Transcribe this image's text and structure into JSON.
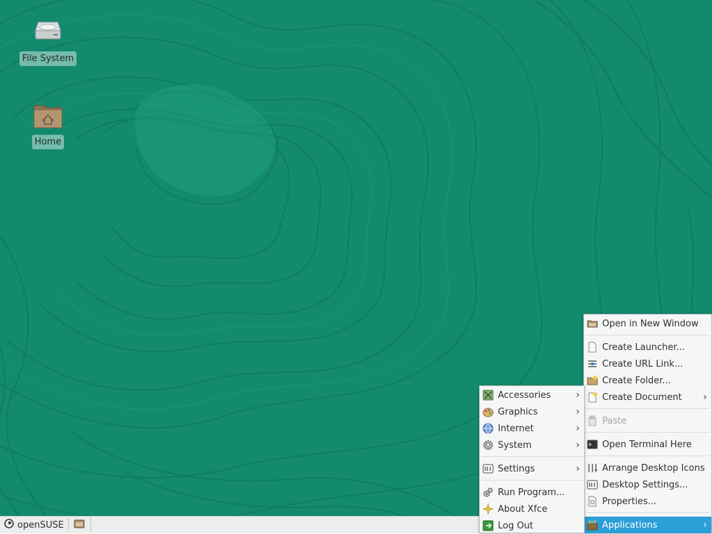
{
  "desktop": {
    "icons": [
      {
        "label": "File System",
        "icon": "drive-icon"
      },
      {
        "label": "Home",
        "icon": "home-folder-icon"
      }
    ]
  },
  "taskbar": {
    "menu_label": "openSUSE",
    "menu_icon": "opensuse-logo-icon",
    "show_desktop_icon": "show-desktop-icon"
  },
  "context_menu": {
    "items": [
      {
        "label": "Open in New Window",
        "icon": "folder-open-icon"
      },
      {
        "label": "Create Launcher...",
        "icon": "document-icon"
      },
      {
        "label": "Create URL Link...",
        "icon": "link-icon"
      },
      {
        "label": "Create Folder...",
        "icon": "new-folder-icon"
      },
      {
        "label": "Create Document",
        "icon": "new-document-icon"
      },
      {
        "label": "Paste",
        "icon": "paste-icon"
      },
      {
        "label": "Open Terminal Here",
        "icon": "terminal-icon"
      },
      {
        "label": "Arrange Desktop Icons",
        "icon": "arrange-icon"
      },
      {
        "label": "Desktop Settings...",
        "icon": "settings-icon"
      },
      {
        "label": "Properties...",
        "icon": "properties-icon"
      },
      {
        "label": "Applications",
        "icon": "applications-icon"
      }
    ]
  },
  "apps_menu": {
    "items": [
      {
        "label": "Accessories",
        "icon": "accessories-icon"
      },
      {
        "label": "Graphics",
        "icon": "graphics-icon"
      },
      {
        "label": "Internet",
        "icon": "internet-globe-icon"
      },
      {
        "label": "System",
        "icon": "system-gear-icon"
      },
      {
        "label": "Settings",
        "icon": "settings-icon"
      },
      {
        "label": "Run Program...",
        "icon": "run-program-icon"
      },
      {
        "label": "About Xfce",
        "icon": "star-icon"
      },
      {
        "label": "Log Out",
        "icon": "logout-icon"
      }
    ]
  },
  "arrow_glyph": "›",
  "colors": {
    "wallpaper": "#138a6e",
    "menu_highlight": "#2b9fd7",
    "taskbar": "#ebeeed"
  }
}
